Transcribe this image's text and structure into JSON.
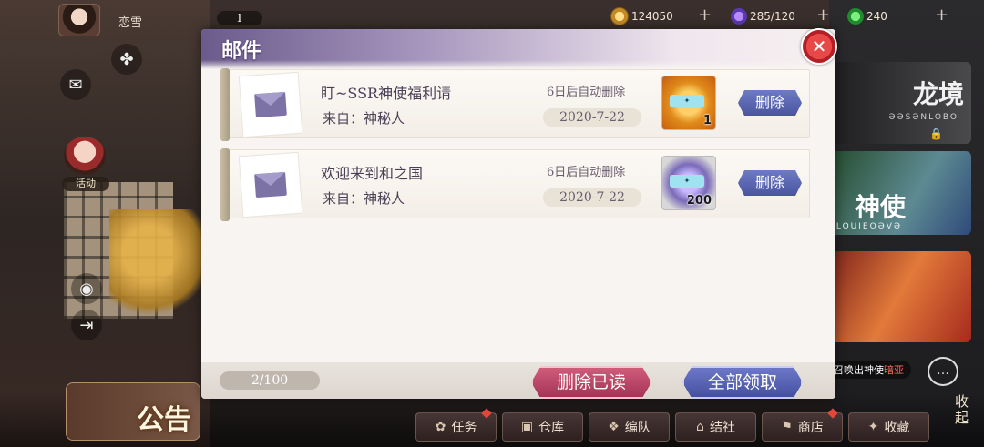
{
  "player": {
    "name": "恋雪",
    "level": "1"
  },
  "resources": [
    {
      "name": "coin",
      "icon": "coin-icon",
      "value": "124050"
    },
    {
      "name": "stamina",
      "icon": "stamina-icon",
      "value": "285/120"
    },
    {
      "name": "jade",
      "icon": "jade-icon",
      "value": "240"
    }
  ],
  "left_menu": {
    "event_label": "活动",
    "notice_label": "公告"
  },
  "banners": {
    "dragon": {
      "title": "龙境",
      "subtitle": "ƏƏSƏNLOBO"
    },
    "angel": {
      "title": "神使",
      "subtitle": "LOUIEOƏVƏ"
    },
    "summon_hint_prefix": "，召唤出神使",
    "summon_hint_highlight": "暗亚"
  },
  "collapse_label": "收起",
  "bottom_nav": [
    {
      "label": "任务",
      "icon": "task-icon",
      "badge": true
    },
    {
      "label": "仓库",
      "icon": "warehouse-icon",
      "badge": false
    },
    {
      "label": "编队",
      "icon": "team-icon",
      "badge": false
    },
    {
      "label": "结社",
      "icon": "guild-icon",
      "badge": false
    },
    {
      "label": "商店",
      "icon": "shop-icon",
      "badge": true
    },
    {
      "label": "收藏",
      "icon": "collection-icon",
      "badge": false
    }
  ],
  "mail": {
    "title": "邮件",
    "items": [
      {
        "subject": "盯~SSR神使福利请",
        "from": "来自：神秘人",
        "expire": "6日后自动删除",
        "date": "2020-7-22",
        "reward_count": "1",
        "delete_label": "删除"
      },
      {
        "subject": "欢迎来到和之国",
        "from": "来自：神秘人",
        "expire": "6日后自动删除",
        "date": "2020-7-22",
        "reward_count": "200",
        "delete_label": "删除"
      }
    ],
    "page_count": "2/100",
    "delete_read_label": "删除已读",
    "claim_all_label": "全部领取"
  }
}
